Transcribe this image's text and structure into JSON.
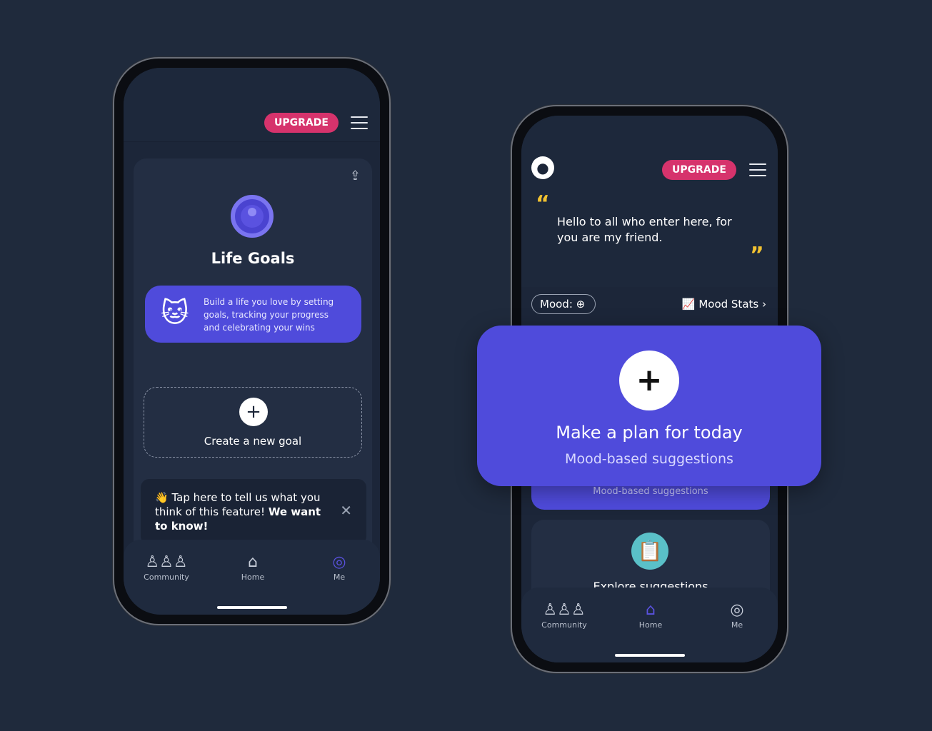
{
  "left_phone": {
    "upgrade_label": "UPGRADE",
    "title": "Life Goals",
    "intro_text": "Build a life you love by setting goals, tracking your progress and celebrating your wins",
    "create_goal_label": "Create a new goal",
    "feedback": {
      "emoji": "👋",
      "text_plain": "Tap here to tell us what you think of this feature! ",
      "text_bold": "We want to know!"
    },
    "tabs": [
      {
        "label": "Community",
        "icon": "community-icon"
      },
      {
        "label": "Home",
        "icon": "home-icon"
      },
      {
        "label": "Me",
        "icon": "target-icon"
      }
    ]
  },
  "right_phone": {
    "upgrade_label": "UPGRADE",
    "quote": "Hello to all who enter here, for you are my friend.",
    "mood_label": "Mood:",
    "mood_stats_label": "Mood Stats",
    "plan_subtitle_behind": "Mood-based suggestions",
    "explore_label": "Explore suggestions",
    "tabs": [
      {
        "label": "Community",
        "icon": "community-icon"
      },
      {
        "label": "Home",
        "icon": "home-icon"
      },
      {
        "label": "Me",
        "icon": "target-icon"
      }
    ]
  },
  "popup": {
    "title": "Make a plan for today",
    "subtitle": "Mood-based suggestions"
  },
  "colors": {
    "background": "#1f2a3c",
    "accent": "#4f4bdb",
    "upgrade": "#d6336c",
    "quote_marks": "#f2c230"
  }
}
